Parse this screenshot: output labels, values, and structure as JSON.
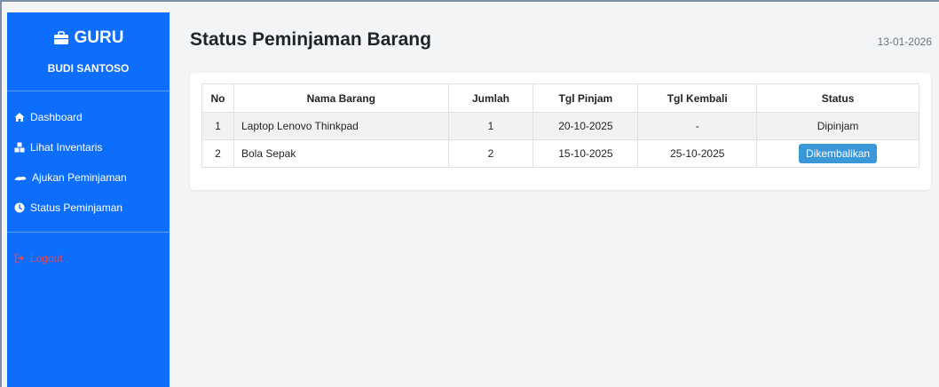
{
  "sidebar": {
    "brand": "GURU",
    "user": "BUDI SANTOSO",
    "items": [
      {
        "label": "Dashboard",
        "icon": "home-icon"
      },
      {
        "label": "Lihat Inventaris",
        "icon": "boxes-icon"
      },
      {
        "label": "Ajukan Peminjaman",
        "icon": "handshake-icon"
      },
      {
        "label": "Status Peminjaman",
        "icon": "clock-icon"
      }
    ],
    "logout": "Logout"
  },
  "header": {
    "title": "Status Peminjaman Barang",
    "date": "13-01-2026"
  },
  "table": {
    "columns": [
      "No",
      "Nama Barang",
      "Jumlah",
      "Tgl Pinjam",
      "Tgl Kembali",
      "Status"
    ],
    "rows": [
      {
        "no": "1",
        "nama": "Laptop Lenovo Thinkpad",
        "jumlah": "1",
        "tgl_pinjam": "20-10-2025",
        "tgl_kembali": "-",
        "status": "Dipinjam"
      },
      {
        "no": "2",
        "nama": "Bola Sepak",
        "jumlah": "2",
        "tgl_pinjam": "15-10-2025",
        "tgl_kembali": "25-10-2025",
        "status": "Dikembalikan"
      }
    ]
  },
  "colors": {
    "sidebar": "#0d6efd",
    "logout": "#e04854",
    "status_button": "#3a97d8"
  }
}
